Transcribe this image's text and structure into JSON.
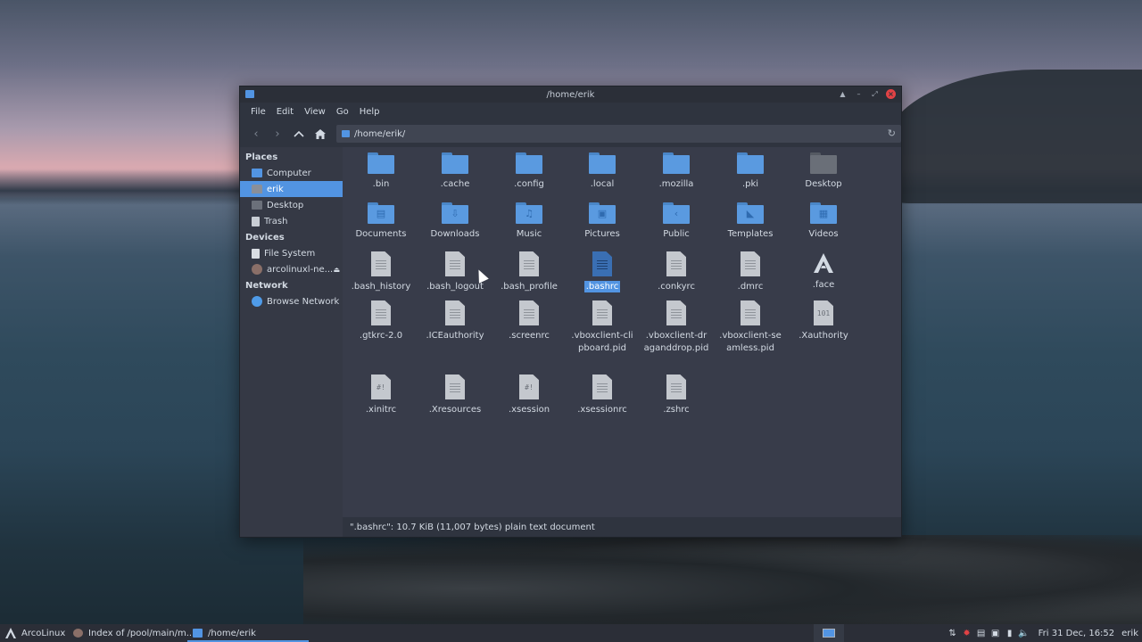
{
  "window": {
    "title": "/home/erik",
    "menu": [
      "File",
      "Edit",
      "View",
      "Go",
      "Help"
    ],
    "location": "/home/erik/"
  },
  "sidebar": {
    "places_header": "Places",
    "places": [
      {
        "label": "Computer",
        "icon": "computer-icon"
      },
      {
        "label": "erik",
        "icon": "home-folder-icon",
        "selected": true
      },
      {
        "label": "Desktop",
        "icon": "desktop-folder-icon"
      },
      {
        "label": "Trash",
        "icon": "trash-icon"
      }
    ],
    "devices_header": "Devices",
    "devices": [
      {
        "label": "File System",
        "icon": "drive-icon"
      },
      {
        "label": "arcolinuxl-ne...",
        "icon": "disc-icon",
        "eject": true
      }
    ],
    "network_header": "Network",
    "network": [
      {
        "label": "Browse Network",
        "icon": "globe-icon"
      }
    ]
  },
  "files": [
    {
      "name": ".bin",
      "type": "folder"
    },
    {
      "name": ".cache",
      "type": "folder"
    },
    {
      "name": ".config",
      "type": "folder"
    },
    {
      "name": ".local",
      "type": "folder"
    },
    {
      "name": ".mozilla",
      "type": "folder"
    },
    {
      "name": ".pki",
      "type": "folder"
    },
    {
      "name": "Desktop",
      "type": "folder-desktop"
    },
    {
      "name": "Documents",
      "type": "folder-documents"
    },
    {
      "name": "Downloads",
      "type": "folder-downloads"
    },
    {
      "name": "Music",
      "type": "folder-music"
    },
    {
      "name": "Pictures",
      "type": "folder-pictures"
    },
    {
      "name": "Public",
      "type": "folder-public"
    },
    {
      "name": "Templates",
      "type": "folder-templates"
    },
    {
      "name": "Videos",
      "type": "folder-videos"
    },
    {
      "name": ".bash_history",
      "type": "text"
    },
    {
      "name": ".bash_logout",
      "type": "text"
    },
    {
      "name": ".bash_profile",
      "type": "text"
    },
    {
      "name": ".bashrc",
      "type": "text-selected",
      "selected": true
    },
    {
      "name": ".conkyrc",
      "type": "text"
    },
    {
      "name": ".dmrc",
      "type": "text"
    },
    {
      "name": ".face",
      "type": "arcolinux-logo"
    },
    {
      "name": ".gtkrc-2.0",
      "type": "text"
    },
    {
      "name": ".ICEauthority",
      "type": "text"
    },
    {
      "name": ".screenrc",
      "type": "text"
    },
    {
      "name": ".vboxclient-clipboard.pid",
      "type": "text"
    },
    {
      "name": ".vboxclient-draganddrop.pid",
      "type": "text"
    },
    {
      "name": ".vboxclient-seamless.pid",
      "type": "text"
    },
    {
      "name": ".Xauthority",
      "type": "binary"
    },
    {
      "name": ".xinitrc",
      "type": "script"
    },
    {
      "name": ".Xresources",
      "type": "text"
    },
    {
      "name": ".xsession",
      "type": "script"
    },
    {
      "name": ".xsessionrc",
      "type": "text"
    },
    {
      "name": ".zshrc",
      "type": "text"
    }
  ],
  "status": "\".bashrc\": 10.7 KiB (11,007 bytes) plain text document",
  "taskbar": {
    "start_label": "ArcoLinux",
    "tasks": [
      {
        "label": "Index of /pool/main/m...",
        "icon": "firefox-icon"
      },
      {
        "label": "/home/erik",
        "icon": "folder-icon",
        "active": true
      }
    ],
    "clock": "Fri 31 Dec, 16:52",
    "user": "erik"
  },
  "colors": {
    "accent": "#5294e2",
    "close": "#e14245"
  }
}
